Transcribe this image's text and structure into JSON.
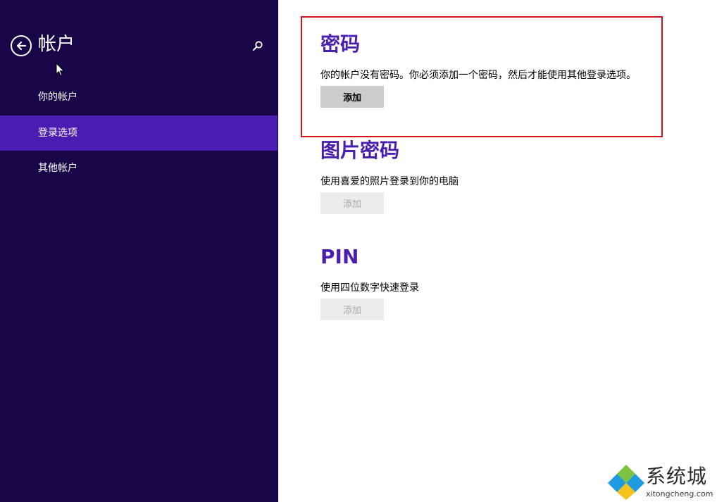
{
  "sidebar": {
    "title": "帐户",
    "back_icon": "back-arrow-icon",
    "search_icon": "search-icon",
    "items": [
      {
        "label": "你的帐户",
        "selected": false
      },
      {
        "label": "登录选项",
        "selected": true
      },
      {
        "label": "其他帐户",
        "selected": false
      }
    ]
  },
  "main": {
    "password": {
      "title": "密码",
      "description": "你的帐户没有密码。你必须添加一个密码，然后才能使用其他登录选项。",
      "button": "添加",
      "enabled": true
    },
    "picture_password": {
      "title": "图片密码",
      "description": "使用喜爱的照片登录到你的电脑",
      "button": "添加",
      "enabled": false
    },
    "pin": {
      "title": "PIN",
      "description": "使用四位数字快速登录",
      "button": "添加",
      "enabled": false
    }
  },
  "watermark": {
    "text": "系统城",
    "url": "xitongcheng.com"
  },
  "colors": {
    "sidebar_bg": "#180649",
    "selected_bg": "#4a1cb2",
    "accent": "#4a1fb0",
    "highlight": "#d4121c"
  }
}
